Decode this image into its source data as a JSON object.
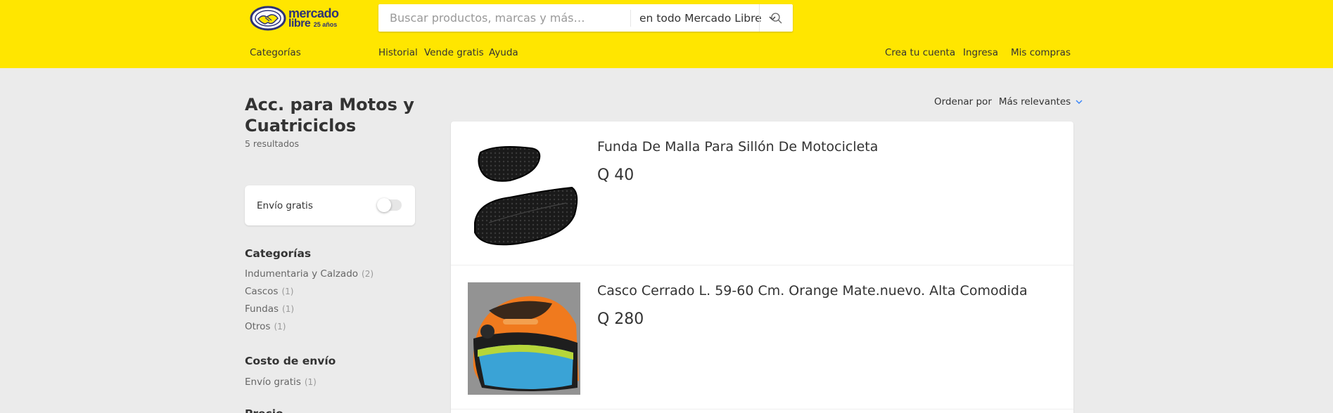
{
  "header": {
    "logo": {
      "line1": "mercado",
      "line2": "libre",
      "line3": "25 años"
    },
    "search": {
      "placeholder": "Buscar productos, marcas y más…",
      "scope": "en todo Mercado Libre"
    },
    "nav_left": {
      "categories": "Categorías",
      "history": "Historial",
      "sell": "Vende gratis",
      "help": "Ayuda"
    },
    "nav_right": {
      "create_account": "Crea tu cuenta",
      "login": "Ingresa",
      "purchases": "Mis compras"
    },
    "colors": {
      "bar": "#ffe600",
      "logo": "#2d3277"
    }
  },
  "sidebar": {
    "title": "Acc. para Motos y Cuatriciclos",
    "results_count": "5 resultados",
    "free_shipping_toggle": {
      "label": "Envío gratis",
      "on": false
    },
    "filters": [
      {
        "title": "Categorías",
        "items": [
          {
            "label": "Indumentaria y Calzado",
            "qty": "(2)"
          },
          {
            "label": "Cascos",
            "qty": "(1)"
          },
          {
            "label": "Fundas",
            "qty": "(1)"
          },
          {
            "label": "Otros",
            "qty": "(1)"
          }
        ]
      },
      {
        "title": "Costo de envío",
        "items": [
          {
            "label": "Envío gratis",
            "qty": "(1)"
          }
        ]
      }
    ],
    "next_filter_partial": "Precio"
  },
  "sort": {
    "label": "Ordenar por",
    "value": "Más relevantes",
    "accent": "#3483fa"
  },
  "results": [
    {
      "title": "Funda De Malla Para Sillón De Motocicleta",
      "price": "Q 40",
      "image_icon": "seat-cover-image"
    },
    {
      "title": "Casco Cerrado L. 59-60 Cm. Orange Mate.nuevo. Alta Comodida",
      "price": "Q 280",
      "image_icon": "helmet-image"
    }
  ]
}
